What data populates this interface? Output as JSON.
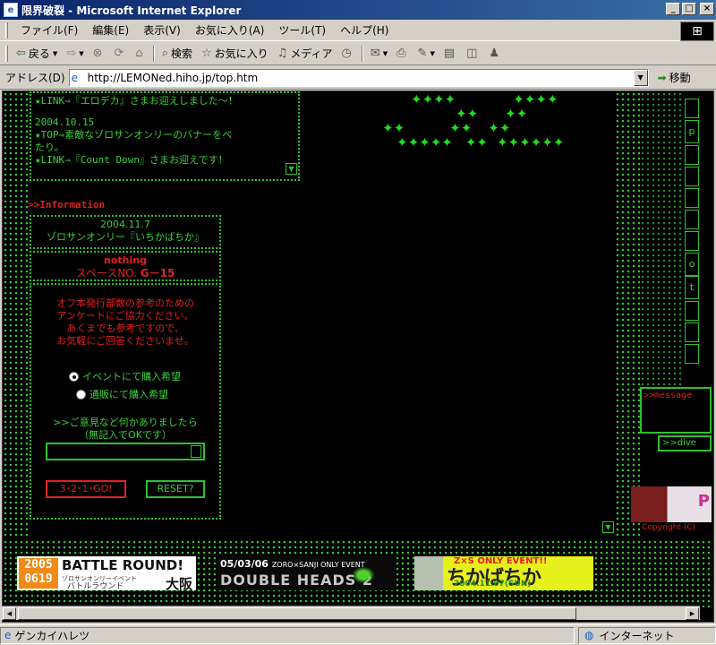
{
  "window": {
    "title": "限界破裂 - Microsoft Internet Explorer",
    "controls": {
      "minimize": "_",
      "maximize": "□",
      "close": "×"
    }
  },
  "menubar": {
    "items": [
      "ファイル(F)",
      "編集(E)",
      "表示(V)",
      "お気に入り(A)",
      "ツール(T)",
      "ヘルプ(H)"
    ]
  },
  "toolbar": {
    "back": "戻る",
    "search": "検索",
    "favorites": "お気に入り",
    "media": "メディア"
  },
  "address": {
    "label": "アドレス(D)",
    "url": "http://LEMONed.hiho.jp/top.htm",
    "go": "移動"
  },
  "page": {
    "news_lines": [
      "★LINK⇒『エロデカ』さまお迎えしました～！",
      "",
      "2004.10.15",
      "★TOP⇒素敵なゾロサンオンリーのバナーをぺ",
      "たり。",
      "★LINK⇒『Count Down』さまお迎えです！"
    ],
    "info_heading": ">>Information",
    "event": {
      "date": "2004.11.7",
      "name": "ゾロサンオンリー『いちかばちか』"
    },
    "space": {
      "status": "nothing",
      "label": "スペースNO.",
      "number": "G－15"
    },
    "survey": {
      "intro": [
        "オフ本発行部数の参考のための",
        "アンケートにご協力ください。",
        "あくまでも参考ですので、",
        "お気軽にご回答くださいませ。"
      ],
      "option1": "イベントにて購入希望",
      "option2": "通販にて購入希望",
      "comment_prompt": ">>ご意見など何かありましたら",
      "comment_note": "（無記入でOKです）",
      "submit": "3･2･1･GO!",
      "reset": "RESET?"
    },
    "right_nav": {
      "letters": [
        "p",
        "o",
        "t"
      ]
    },
    "message_label": ">>message",
    "dive_label": ">>dive",
    "copyright": "Copyright (C)",
    "banners": {
      "battle": {
        "year_top": "2005",
        "year_bottom": "0619",
        "title": "BATTLE ROUND!",
        "sub": "ゾロサンオンリーイベント",
        "kana": "バトルラウンド",
        "city": "大阪"
      },
      "double": {
        "date": "05/03/06",
        "sub": "ZORO×SANJI ONLY EVENT",
        "title": "DOUBLE HEADS 2"
      },
      "chika": {
        "head": "Z×S ONLY EVENT!!",
        "title": "ちかばちか",
        "date": "2004.11.07(SUN)"
      }
    }
  },
  "status": {
    "left": "ゲンカイハレツ",
    "zone": "インターネット"
  },
  "colors": {
    "accent_green": "#39d139",
    "accent_red": "#e02020",
    "bg": "#000000"
  }
}
